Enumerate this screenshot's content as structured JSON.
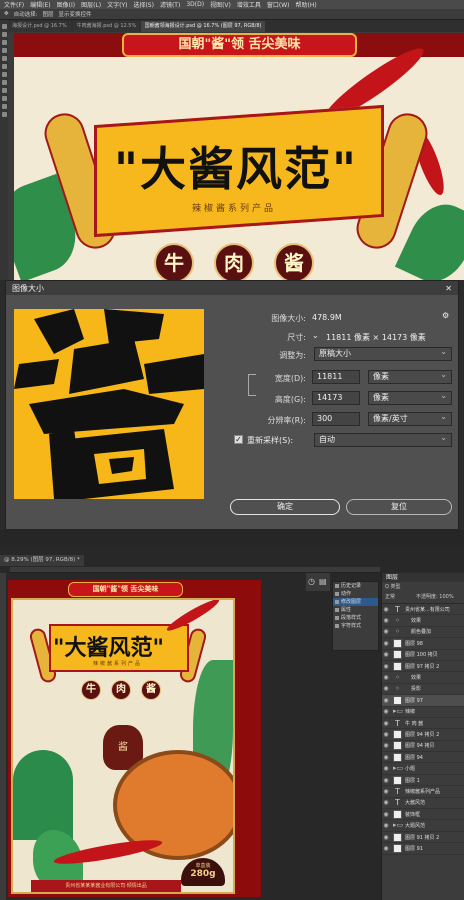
{
  "menubar": [
    "文件(F)",
    "编辑(E)",
    "图像(I)",
    "图层(L)",
    "文字(Y)",
    "选择(S)",
    "滤镜(T)",
    "3D(D)",
    "视图(V)",
    "增效工具",
    "窗口(W)",
    "帮助(H)"
  ],
  "options_bar": [
    "自动选择:",
    "图层",
    "显示变换控件"
  ],
  "doc_tabs": [
    {
      "label": "海报设计.psd @ 16.7%",
      "active": false
    },
    {
      "label": "牛肉酱海报.psd @ 12.5%",
      "active": false
    },
    {
      "label": "国朝酱领海报设计.psd @ 16.7% (图层 97, RGB/8)",
      "active": true
    }
  ],
  "poster": {
    "banner": "国朝\"酱\"领  舌尖美味",
    "title": "\"大酱风范\"",
    "title_chars": [
      "大",
      "酱",
      "风",
      "范"
    ],
    "subtitle": "辣椒酱系列产品",
    "badges": [
      "牛",
      "肉",
      "酱"
    ],
    "jar_label": "酱",
    "price_label": "单盒装",
    "price": "280g",
    "company": "贵州省某某某酱业有限公司·倾情出品"
  },
  "dialog": {
    "title": "图像大小",
    "image_size_label": "图像大小:",
    "image_size_value": "478.9M",
    "dimensions_label": "尺寸:",
    "dimensions_value": "11811 像素 × 14173 像素",
    "fit_label": "调整为:",
    "fit_value": "原稿大小",
    "width_label": "宽度(D):",
    "width_value": "11811",
    "width_unit": "像素",
    "height_label": "高度(G):",
    "height_value": "14173",
    "height_unit": "像素",
    "resolution_label": "分辨率(R):",
    "resolution_value": "300",
    "resolution_unit": "像素/英寸",
    "resample_label": "重新采样(S):",
    "resample_value": "自动",
    "ok_label": "确定",
    "reset_label": "复位"
  },
  "bottom": {
    "doc_tab": "@ 8.29% (图层 97, RGB/8) *",
    "history_items": [
      "历史记录",
      "动作",
      "修改图层",
      "属性",
      "段落样式",
      "字符样式"
    ],
    "layers_title": "图层",
    "layers_kind": "Q 类型",
    "layers_mode": "正常",
    "layers_opacity": "不透明度: 100%",
    "layers_fill": "填充: 100%",
    "layers": [
      {
        "name": "贵州省某...有限公司",
        "kind": "text"
      },
      {
        "name": "效果",
        "kind": "fx"
      },
      {
        "name": "颜色叠加",
        "kind": "fx"
      },
      {
        "name": "图层 98",
        "kind": "pixel"
      },
      {
        "name": "图层 100 拷贝",
        "kind": "pixel"
      },
      {
        "name": "图层 97 拷贝 2",
        "kind": "pixel"
      },
      {
        "name": "效果",
        "kind": "fx"
      },
      {
        "name": "投影",
        "kind": "fx"
      },
      {
        "name": "图层 97",
        "kind": "pixel",
        "selected": true
      },
      {
        "name": "辣椒",
        "kind": "folder"
      },
      {
        "name": "牛 肉 酱",
        "kind": "text"
      },
      {
        "name": "图层 94 拷贝 2",
        "kind": "pixel"
      },
      {
        "name": "图层 94 拷贝",
        "kind": "pixel"
      },
      {
        "name": "图层 94",
        "kind": "pixel"
      },
      {
        "name": "小题",
        "kind": "folder"
      },
      {
        "name": "图层 1",
        "kind": "pixel"
      },
      {
        "name": "辣椒酱系列产品",
        "kind": "text"
      },
      {
        "name": "大酱风范",
        "kind": "text"
      },
      {
        "name": "装饰框",
        "kind": "pixel"
      },
      {
        "name": "大题风范",
        "kind": "folder"
      },
      {
        "name": "图层 91 拷贝 2",
        "kind": "pixel"
      },
      {
        "name": "图层 91",
        "kind": "pixel"
      }
    ]
  },
  "colors": {
    "poster_red": "#8e0b0b",
    "gold": "#e6b43a",
    "cream": "#f1e7d1",
    "chili": "#c3141a",
    "dialog_bg": "#505050"
  }
}
